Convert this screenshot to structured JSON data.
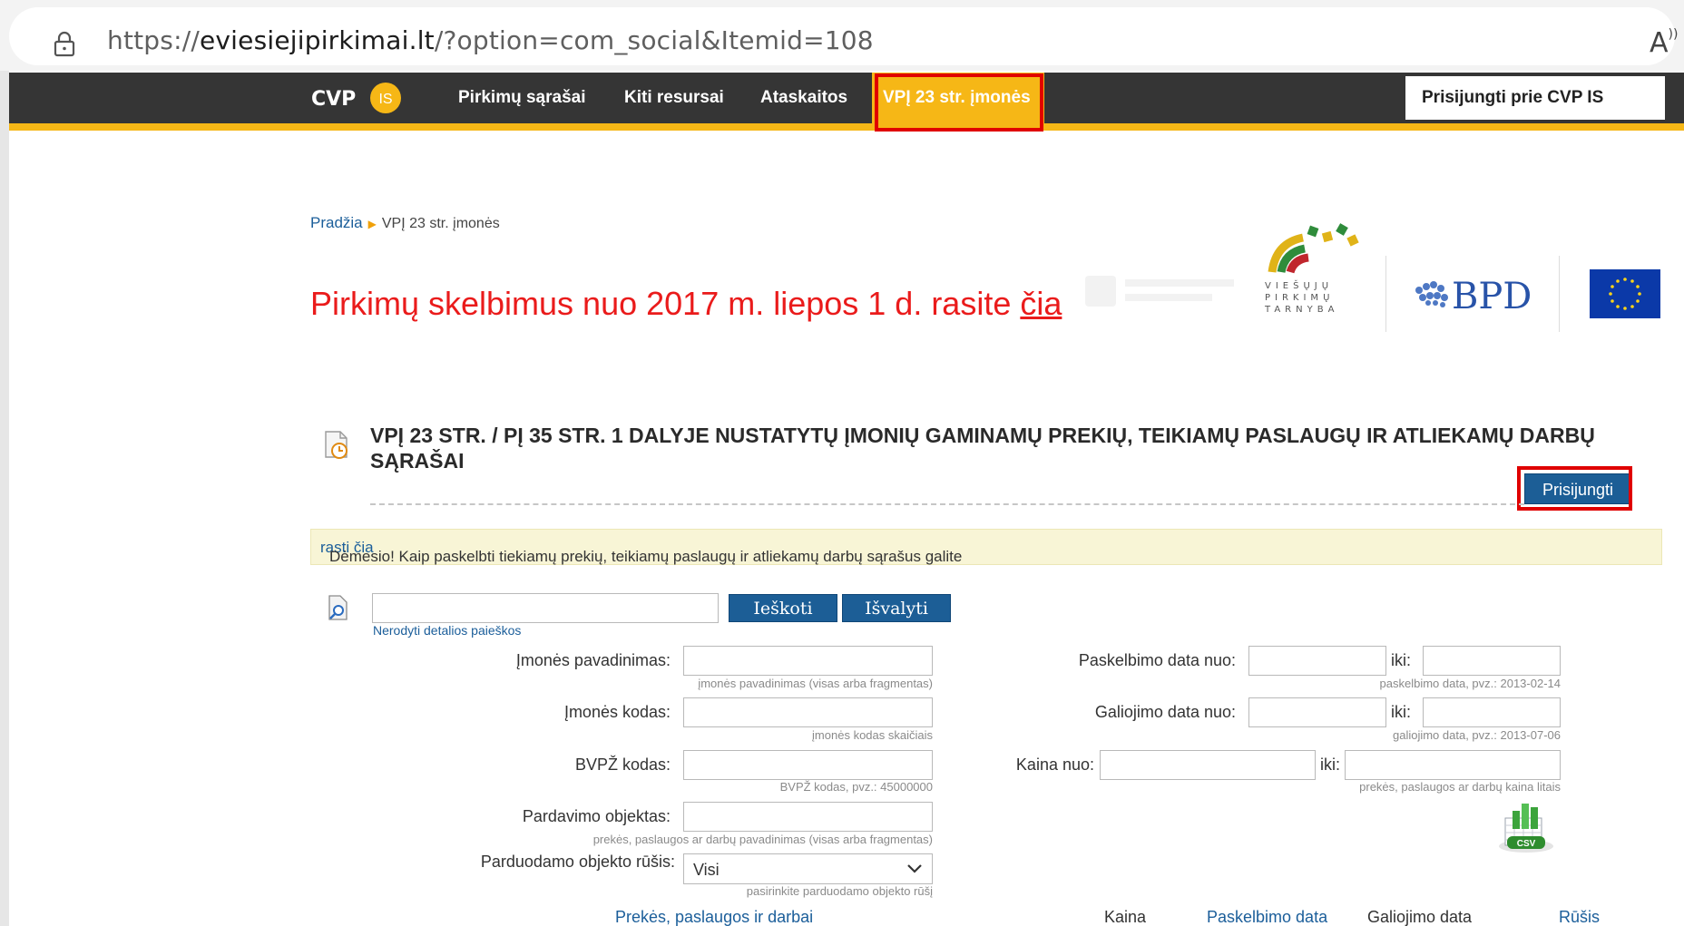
{
  "browser": {
    "url_prefix": "https://",
    "url_domain": "eviesiejipirkimai.lt",
    "url_path": "/?option=com_social&Itemid=108"
  },
  "nav": {
    "logo_text": "CVP",
    "logo_badge": "IS",
    "items": [
      "Pirkimų sąrašai",
      "Kiti resursai",
      "Ataskaitos"
    ],
    "active_item": "VPĮ 23 str. įmonės",
    "login_label": "Prisijungti prie CVP IS",
    "accent_color": "#f6b716"
  },
  "breadcrumb": {
    "home": "Pradžia",
    "current": "VPĮ 23 str. įmonės"
  },
  "headline": {
    "text": "Pirkimų skelbimus nuo 2017 m. liepos 1 d. rasite ",
    "link": "čia"
  },
  "partners": {
    "vpt_lines": [
      "VIEŠŲJŲ",
      "PIRKIMŲ",
      "TARNYBA"
    ],
    "bpd": "BPD"
  },
  "section": {
    "title": "VPĮ 23 STR. / PĮ 35 STR. 1 DALYJE NUSTATYTŲ ĮMONIŲ GAMINAMŲ PREKIŲ, TEIKIAMŲ PASLAUGŲ IR ATLIEKAMŲ DARBŲ SĄRAŠAI",
    "login_button": "Prisijungti"
  },
  "notice": {
    "text": "Dėmesio! Kaip paskelbti tiekiamų prekių, teikiamų paslaugų ir atliekamų darbų sąrašus galite ",
    "link": "rasti čia"
  },
  "search": {
    "query": "",
    "search_button": "Ieškoti",
    "clear_button": "Išvalyti",
    "detail_toggle": "Nerodyti detalios paieškos"
  },
  "filters": {
    "company_name": {
      "label": "Įmonės pavadinimas:",
      "value": "",
      "hint": "įmonės pavadinimas (visas arba fragmentas)"
    },
    "company_code": {
      "label": "Įmonės kodas:",
      "value": "",
      "hint": "įmonės kodas skaičiais"
    },
    "bvpz_code": {
      "label": "BVPŽ kodas:",
      "value": "",
      "hint": "BVPŽ kodas, pvz.: 45000000"
    },
    "sale_object": {
      "label": "Pardavimo objektas:",
      "value": "",
      "hint": "prekės, paslaugos ar darbų pavadinimas (visas arba fragmentas)"
    },
    "object_type": {
      "label": "Parduodamo objekto rūšis:",
      "selected": "Visi",
      "hint": "pasirinkite parduodamo objekto rūšį"
    },
    "publish_date": {
      "label": "Paskelbimo data nuo:",
      "to_label": "iki:",
      "hint": "paskelbimo data, pvz.: 2013-02-14"
    },
    "valid_date": {
      "label": "Galiojimo data nuo:",
      "to_label": "iki:",
      "hint": "galiojimo data, pvz.: 2013-07-06"
    },
    "price": {
      "label": "Kaina nuo:",
      "to_label": "iki:",
      "hint": "prekės, paslaugos ar darbų kaina litais"
    },
    "csv_label": "CSV"
  },
  "table": {
    "columns": [
      "Prekės, paslaugos ir darbai",
      "Kaina",
      "Paskelbimo data",
      "Galiojimo data",
      "Rūšis"
    ]
  }
}
